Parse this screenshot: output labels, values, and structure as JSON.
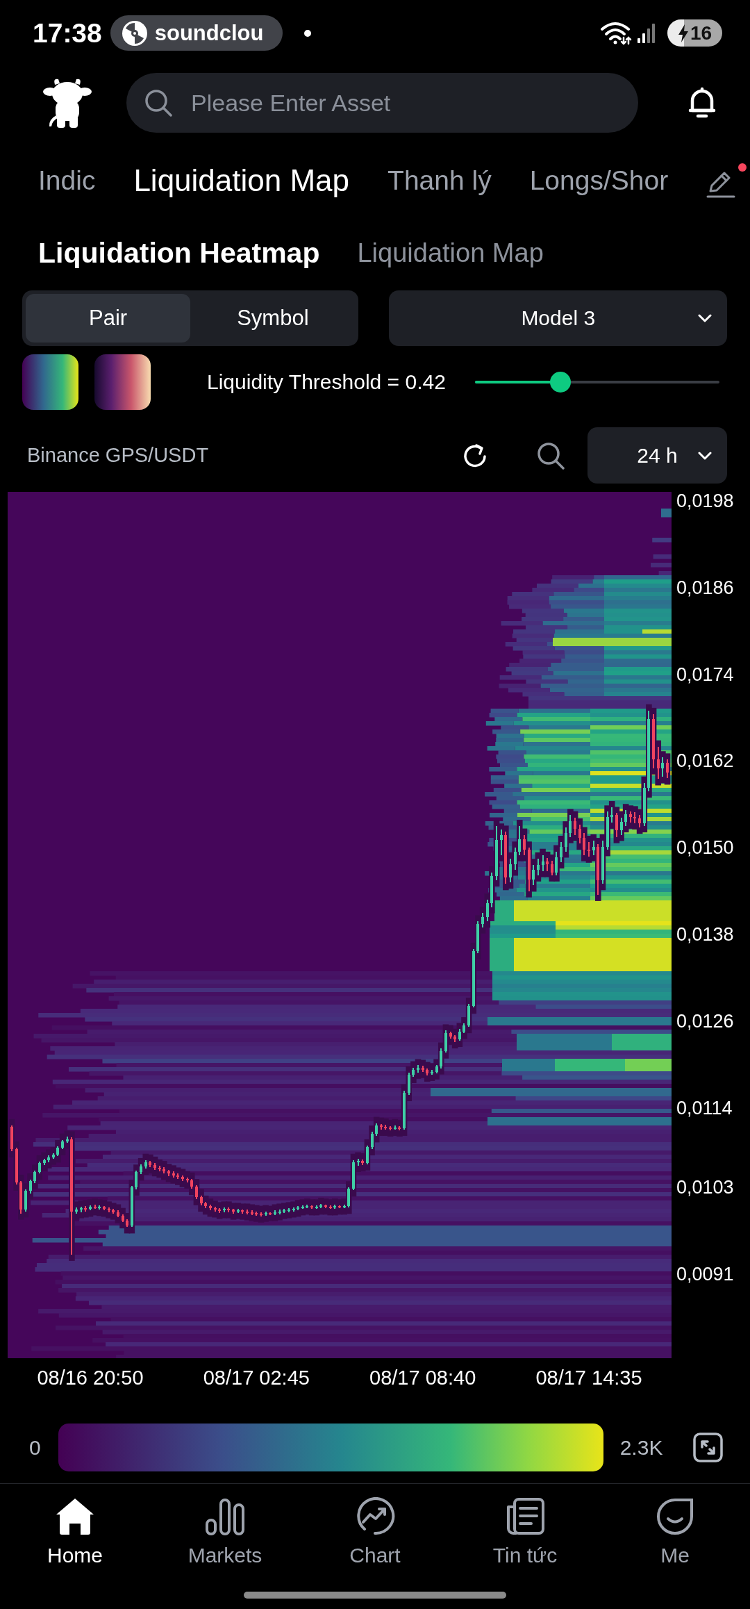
{
  "status_bar": {
    "time": "17:38",
    "media_pill": "soundclou",
    "battery": "16"
  },
  "search": {
    "placeholder": "Please Enter Asset"
  },
  "tabs": [
    {
      "label": "Indic",
      "selected": false
    },
    {
      "label": "Liquidation Map",
      "selected": true
    },
    {
      "label": "Thanh lý",
      "selected": false
    },
    {
      "label": "Longs/Shor",
      "selected": false
    }
  ],
  "edit_button": {
    "badge": true
  },
  "sub_tabs": [
    {
      "label": "Liquidation Heatmap",
      "selected": true
    },
    {
      "label": "Liquidation Map",
      "selected": false
    }
  ],
  "mode_toggle": [
    {
      "label": "Pair",
      "selected": true
    },
    {
      "label": "Symbol",
      "selected": false
    }
  ],
  "model_select": {
    "value": "Model 3"
  },
  "color_schemes": [
    {
      "kind": "viridis"
    },
    {
      "kind": "magma"
    }
  ],
  "threshold": {
    "label": "Liquidity Threshold = 0.42",
    "level": 0.35
  },
  "chart_header": {
    "pair": "Binance GPS/USDT",
    "range": "24 h"
  },
  "heatmap": {
    "chart_data": {
      "type": "candlestick",
      "categories": [
        null,
        null,
        null,
        null,
        null,
        null,
        null,
        null,
        null,
        null,
        null,
        null,
        null,
        null,
        null,
        null,
        null,
        "08/16 20:50",
        null,
        null,
        null,
        null,
        null,
        null,
        null,
        null,
        null,
        null,
        null,
        null,
        null,
        null,
        null,
        null,
        null,
        null,
        null,
        null,
        null,
        null,
        null,
        null,
        null,
        null,
        null,
        null,
        null,
        null,
        null,
        null,
        null,
        null,
        null,
        "08/17 02:45",
        null,
        null,
        null,
        null,
        null,
        null,
        null,
        null,
        null,
        null,
        null,
        null,
        null,
        null,
        null,
        null,
        null,
        null,
        null,
        null,
        null,
        null,
        null,
        null,
        null,
        null,
        null,
        null,
        null,
        null,
        null,
        null,
        null,
        null,
        null,
        "08/17 08:40",
        null,
        null,
        null,
        null,
        null,
        null,
        null,
        null,
        null,
        null,
        null,
        null,
        null,
        null,
        null,
        null,
        null,
        null,
        null,
        null,
        null,
        null,
        null,
        null,
        null,
        null,
        null,
        null,
        null,
        null,
        null,
        null,
        null,
        null,
        null,
        "08/17 14:35",
        null,
        null,
        null,
        null,
        null,
        null,
        null,
        null,
        null,
        null,
        null,
        null,
        null,
        null,
        null,
        null,
        null
      ],
      "ohlc": [
        [
          0.01114,
          0.01116,
          0.0108,
          0.01083
        ],
        [
          0.01083,
          0.01085,
          0.01034,
          0.01037
        ],
        [
          0.01037,
          0.01039,
          0.00994,
          0.00999
        ],
        [
          0.00999,
          0.01027,
          0.00997,
          0.01025
        ],
        [
          0.01025,
          0.01041,
          0.01022,
          0.01039
        ],
        [
          0.01039,
          0.01053,
          0.01036,
          0.01051
        ],
        [
          0.01051,
          0.01066,
          0.01049,
          0.01064
        ],
        [
          0.01064,
          0.0107,
          0.01061,
          0.01068
        ],
        [
          0.01068,
          0.01074,
          0.01065,
          0.01072
        ],
        [
          0.01072,
          0.01077,
          0.0107,
          0.01075
        ],
        [
          0.01075,
          0.01087,
          0.01073,
          0.01085
        ],
        [
          0.01085,
          0.01096,
          0.01083,
          0.01094
        ],
        [
          0.01094,
          0.011,
          0.01092,
          0.01097
        ],
        [
          0.01097,
          0.01099,
          0.00937,
          0.00997
        ],
        [
          0.00997,
          0.01002,
          0.00994,
          0.00999
        ],
        [
          0.00999,
          0.01003,
          0.00996,
          0.01001
        ],
        [
          0.01001,
          0.01004,
          0.00997,
          0.01
        ],
        [
          0.01,
          0.01005,
          0.00998,
          0.01003
        ],
        [
          0.01003,
          0.01006,
          0.01,
          0.01002
        ],
        [
          0.01002,
          0.01005,
          0.00999,
          0.01003
        ],
        [
          0.01003,
          0.01004,
          0.00998,
          0.01
        ],
        [
          0.01,
          0.01002,
          0.00996,
          0.00998
        ],
        [
          0.00998,
          0.01,
          0.00994,
          0.00996
        ],
        [
          0.00996,
          0.00998,
          0.00989,
          0.00991
        ],
        [
          0.00991,
          0.00993,
          0.00982,
          0.00984
        ],
        [
          0.00984,
          0.00986,
          0.00975,
          0.00977
        ],
        [
          0.00977,
          0.01032,
          0.00975,
          0.0103
        ],
        [
          0.0103,
          0.01053,
          0.01027,
          0.01051
        ],
        [
          0.01051,
          0.01062,
          0.01048,
          0.01059
        ],
        [
          0.01059,
          0.01068,
          0.01056,
          0.01065
        ],
        [
          0.01065,
          0.01067,
          0.01058,
          0.01061
        ],
        [
          0.01061,
          0.01064,
          0.01054,
          0.01057
        ],
        [
          0.01057,
          0.0106,
          0.01052,
          0.01055
        ],
        [
          0.01055,
          0.01058,
          0.01049,
          0.01052
        ],
        [
          0.01052,
          0.01054,
          0.01046,
          0.01049
        ],
        [
          0.01049,
          0.01052,
          0.01044,
          0.01047
        ],
        [
          0.01047,
          0.01049,
          0.01042,
          0.01045
        ],
        [
          0.01045,
          0.01047,
          0.01039,
          0.01042
        ],
        [
          0.01042,
          0.01044,
          0.01037,
          0.0104
        ],
        [
          0.0104,
          0.01042,
          0.01028,
          0.01031
        ],
        [
          0.01031,
          0.01033,
          0.01014,
          0.01017
        ],
        [
          0.01017,
          0.01019,
          0.01005,
          0.01008
        ],
        [
          0.01008,
          0.0101,
          0.01001,
          0.01004
        ],
        [
          0.01004,
          0.01006,
          0.00998,
          0.01001
        ],
        [
          0.01001,
          0.01003,
          0.00997,
          0.00999
        ],
        [
          0.00999,
          0.01001,
          0.00995,
          0.00998
        ],
        [
          0.00998,
          0.01002,
          0.00996,
          0.01
        ],
        [
          0.01,
          0.01002,
          0.00996,
          0.00999
        ],
        [
          0.00999,
          0.01,
          0.00994,
          0.00997
        ],
        [
          0.00997,
          0.01,
          0.00995,
          0.00998
        ],
        [
          0.00998,
          0.00999,
          0.00994,
          0.00997
        ],
        [
          0.00997,
          0.00999,
          0.00993,
          0.00996
        ],
        [
          0.00996,
          0.00998,
          0.00992,
          0.00995
        ],
        [
          0.00995,
          0.00997,
          0.00991,
          0.00994
        ],
        [
          0.00994,
          0.00996,
          0.0099,
          0.00993
        ],
        [
          0.00993,
          0.00997,
          0.00991,
          0.00995
        ],
        [
          0.00995,
          0.00996,
          0.00992,
          0.00994
        ],
        [
          0.00994,
          0.00998,
          0.00992,
          0.00996
        ],
        [
          0.00996,
          0.00999,
          0.00993,
          0.00997
        ],
        [
          0.00997,
          0.01,
          0.00995,
          0.00998
        ],
        [
          0.00998,
          0.01001,
          0.00996,
          0.00999
        ],
        [
          0.00999,
          0.01002,
          0.00997,
          0.01
        ],
        [
          0.01,
          0.01004,
          0.00998,
          0.01002
        ],
        [
          0.01002,
          0.01005,
          0.01,
          0.01003
        ],
        [
          0.01003,
          0.01006,
          0.01001,
          0.01004
        ],
        [
          0.01004,
          0.01005,
          0.01,
          0.01002
        ],
        [
          0.01002,
          0.01005,
          0.01,
          0.01003
        ],
        [
          0.01003,
          0.01007,
          0.01001,
          0.01005
        ],
        [
          0.01005,
          0.01006,
          0.01001,
          0.01003
        ],
        [
          0.01003,
          0.01005,
          0.01,
          0.01002
        ],
        [
          0.01002,
          0.01006,
          0.01,
          0.01004
        ],
        [
          0.01004,
          0.01005,
          0.01001,
          0.01003
        ],
        [
          0.01003,
          0.01006,
          0.01001,
          0.01004
        ],
        [
          0.01004,
          0.0103,
          0.01002,
          0.01028
        ],
        [
          0.01028,
          0.01068,
          0.01026,
          0.01065
        ],
        [
          0.01065,
          0.0107,
          0.0106,
          0.01067
        ],
        [
          0.01067,
          0.01069,
          0.01061,
          0.01064
        ],
        [
          0.01064,
          0.01088,
          0.01062,
          0.01086
        ],
        [
          0.01086,
          0.01107,
          0.01083,
          0.01104
        ],
        [
          0.01104,
          0.01119,
          0.01101,
          0.01116
        ],
        [
          0.01116,
          0.01118,
          0.0111,
          0.01114
        ],
        [
          0.01114,
          0.01117,
          0.0111,
          0.01113
        ],
        [
          0.01113,
          0.01115,
          0.01109,
          0.01112
        ],
        [
          0.01112,
          0.01116,
          0.0111,
          0.01113
        ],
        [
          0.01113,
          0.01115,
          0.01109,
          0.01112
        ],
        [
          0.01112,
          0.01164,
          0.0111,
          0.01161
        ],
        [
          0.01161,
          0.01189,
          0.01158,
          0.01186
        ],
        [
          0.01186,
          0.01196,
          0.01183,
          0.01193
        ],
        [
          0.01193,
          0.01199,
          0.01189,
          0.01196
        ],
        [
          0.01196,
          0.01198,
          0.0119,
          0.01193
        ],
        [
          0.01193,
          0.01195,
          0.01185,
          0.01188
        ],
        [
          0.01188,
          0.01193,
          0.01186,
          0.0119
        ],
        [
          0.0119,
          0.01199,
          0.01188,
          0.01197
        ],
        [
          0.01197,
          0.01222,
          0.01195,
          0.01219
        ],
        [
          0.01219,
          0.01247,
          0.01217,
          0.01244
        ],
        [
          0.01244,
          0.01246,
          0.01236,
          0.01239
        ],
        [
          0.01239,
          0.01241,
          0.01231,
          0.01235
        ],
        [
          0.01235,
          0.01249,
          0.01233,
          0.01246
        ],
        [
          0.01246,
          0.01257,
          0.01244,
          0.01254
        ],
        [
          0.01254,
          0.01284,
          0.01252,
          0.01281
        ],
        [
          0.01281,
          0.0136,
          0.01279,
          0.01357
        ],
        [
          0.01357,
          0.01398,
          0.01354,
          0.01395
        ],
        [
          0.01395,
          0.0141,
          0.0139,
          0.01404
        ],
        [
          0.01404,
          0.01428,
          0.01398,
          0.01423
        ],
        [
          0.01423,
          0.01466,
          0.01418,
          0.01461
        ],
        [
          0.01461,
          0.0153,
          0.01455,
          0.01511
        ],
        [
          0.01511,
          0.01525,
          0.0149,
          0.01518
        ],
        [
          0.01518,
          0.01522,
          0.0145,
          0.01459
        ],
        [
          0.01459,
          0.01485,
          0.01452,
          0.01477
        ],
        [
          0.01477,
          0.015,
          0.0147,
          0.01495
        ],
        [
          0.01495,
          0.0153,
          0.0149,
          0.01512
        ],
        [
          0.01512,
          0.01518,
          0.0149,
          0.01497
        ],
        [
          0.01497,
          0.015,
          0.0144,
          0.01456
        ],
        [
          0.01456,
          0.01476,
          0.01448,
          0.0147
        ],
        [
          0.0147,
          0.01485,
          0.01462,
          0.01476
        ],
        [
          0.01476,
          0.0149,
          0.01468,
          0.01481
        ],
        [
          0.01481,
          0.01486,
          0.01468,
          0.01477
        ],
        [
          0.01477,
          0.01482,
          0.01462,
          0.01466
        ],
        [
          0.01466,
          0.01495,
          0.01462,
          0.01487
        ],
        [
          0.01487,
          0.01508,
          0.0148,
          0.01501
        ],
        [
          0.01501,
          0.01528,
          0.01495,
          0.0152
        ],
        [
          0.0152,
          0.01545,
          0.01515,
          0.01537
        ],
        [
          0.01537,
          0.01542,
          0.01518,
          0.01526
        ],
        [
          0.01526,
          0.01532,
          0.01506,
          0.01514
        ],
        [
          0.01514,
          0.0152,
          0.0149,
          0.01497
        ],
        [
          0.01497,
          0.01508,
          0.01488,
          0.01496
        ],
        [
          0.01496,
          0.0151,
          0.0149,
          0.01501
        ],
        [
          0.01501,
          0.01505,
          0.01435,
          0.01455
        ],
        [
          0.01455,
          0.0151,
          0.0145,
          0.01501
        ],
        [
          0.01501,
          0.0155,
          0.01497,
          0.01543
        ],
        [
          0.01543,
          0.01556,
          0.01535,
          0.01545
        ],
        [
          0.01545,
          0.01548,
          0.01515,
          0.01524
        ],
        [
          0.01524,
          0.01542,
          0.01518,
          0.01536
        ],
        [
          0.01536,
          0.01552,
          0.0153,
          0.01546
        ],
        [
          0.01546,
          0.0155,
          0.01535,
          0.01543
        ],
        [
          0.01543,
          0.01549,
          0.01534,
          0.01541
        ],
        [
          0.01541,
          0.01545,
          0.01528,
          0.01534
        ],
        [
          0.01534,
          0.0159,
          0.0153,
          0.01583
        ],
        [
          0.01583,
          0.0169,
          0.01578,
          0.01678
        ],
        [
          0.01678,
          0.01685,
          0.0161,
          0.01622
        ],
        [
          0.01622,
          0.0164,
          0.01595,
          0.0161
        ],
        [
          0.0161,
          0.01625,
          0.01598,
          0.01618
        ],
        [
          0.01618,
          0.01622,
          0.01596,
          0.01604
        ]
      ],
      "ylim": [
        0.007937,
        0.019925
      ],
      "yticks": [
        {
          "value": 0.0198,
          "label": "0,0198"
        },
        {
          "value": 0.0186,
          "label": "0,0186"
        },
        {
          "value": 0.0174,
          "label": "0,0174"
        },
        {
          "value": 0.0162,
          "label": "0,0162"
        },
        {
          "value": 0.015,
          "label": "0,0150"
        },
        {
          "value": 0.0138,
          "label": "0,0138"
        },
        {
          "value": 0.0126,
          "label": "0,0126"
        },
        {
          "value": 0.0114,
          "label": "0,0114"
        },
        {
          "value": 0.0103,
          "label": "0,0103"
        },
        {
          "value": 0.0091,
          "label": "0,0091"
        }
      ]
    }
  },
  "legend": {
    "min": "0",
    "max": "2.3K"
  },
  "nav": [
    {
      "kind": "home",
      "label": "Home",
      "selected": true
    },
    {
      "kind": "markets",
      "label": "Markets",
      "selected": false
    },
    {
      "kind": "chart",
      "label": "Chart",
      "selected": false
    },
    {
      "kind": "news",
      "label": "Tin tức",
      "selected": false
    },
    {
      "kind": "profile",
      "label": "Me",
      "selected": false
    }
  ]
}
